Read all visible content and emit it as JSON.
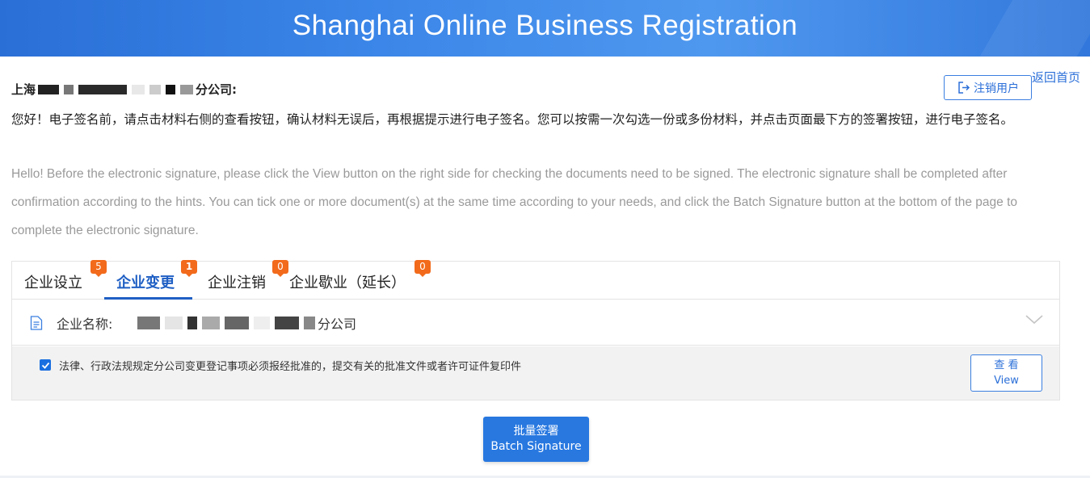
{
  "header": {
    "title": "Shanghai Online Business Registration",
    "background_color": "#3b86e8"
  },
  "top_links": {
    "back_home": "返回首页",
    "logout": "注销用户"
  },
  "greeting": {
    "prefix": "上海",
    "suffix": "分公司:",
    "zh_text": "您好！电子签名前，请点击材料右侧的查看按钮，确认材料无误后，再根据提示进行电子签名。您可以按需一次勾选一份或多份材料，并点击页面最下方的签署按钮，进行电子签名。",
    "en_text": "Hello! Before the electronic signature, please click the View button on the right side for checking the documents need to be signed. The electronic signature shall be completed after confirmation according to the hints. You can tick one or more document(s) at the same time according to your needs, and click the Batch Signature button at the bottom of the page to complete the electronic signature."
  },
  "tabs": [
    {
      "label": "企业设立",
      "badge": "5"
    },
    {
      "label": "企业变更",
      "badge": "1"
    },
    {
      "label": "企业注销",
      "badge": "0"
    },
    {
      "label": "企业歇业（延长）",
      "badge": "0"
    }
  ],
  "active_tab": "企业变更",
  "company": {
    "label": "企业名称:",
    "name_suffix": "分公司"
  },
  "document": {
    "checked": true,
    "text": "法律、行政法规规定分公司变更登记事项必须报经批准的，提交有关的批准文件或者许可证件复印件",
    "view_zh": "查 看",
    "view_en": "View"
  },
  "batch_sign": {
    "zh": "批量签署",
    "en": "Batch Signature"
  },
  "colors": {
    "accent": "#2b6fd8",
    "badge": "#f26a1b",
    "primary_button": "#2878e0"
  }
}
